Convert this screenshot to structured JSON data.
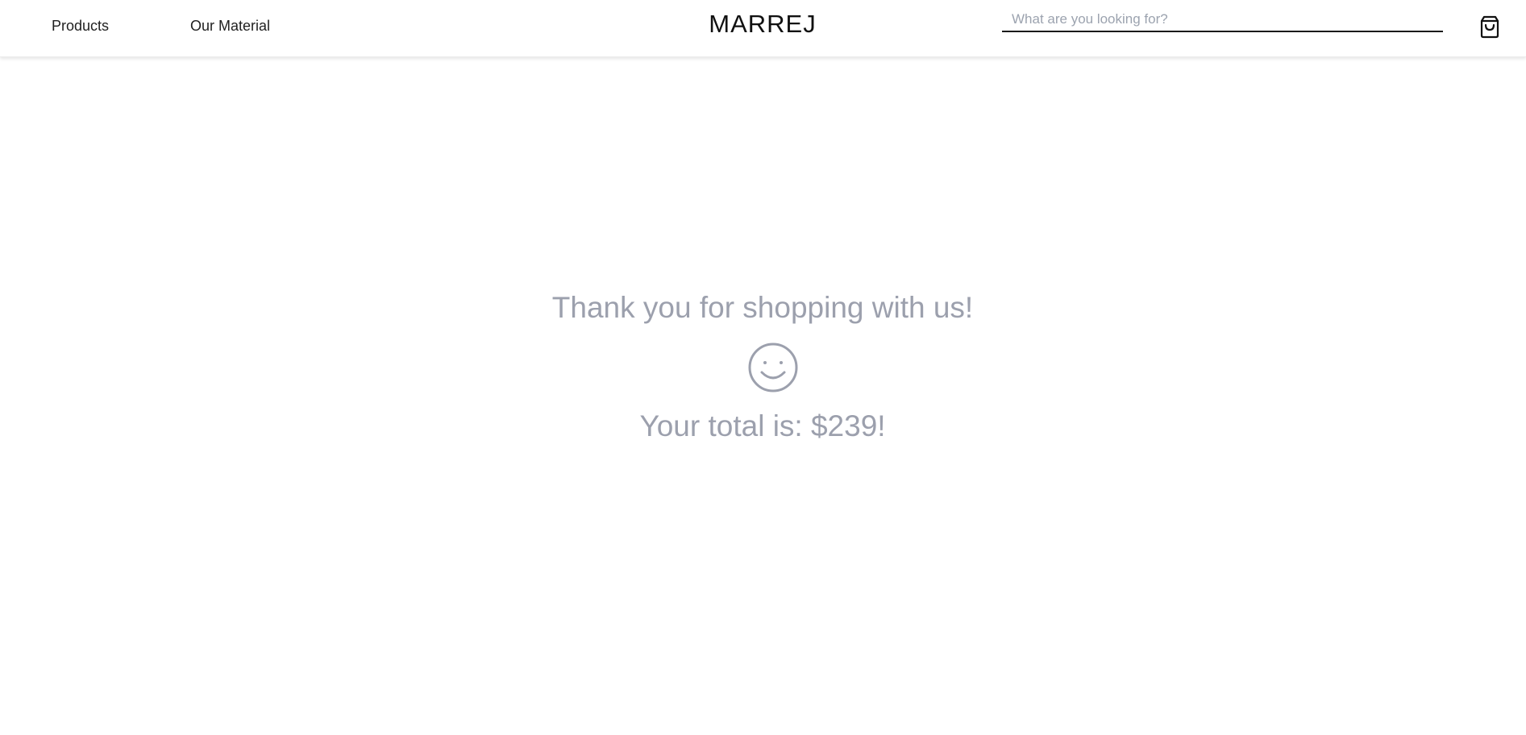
{
  "header": {
    "nav": [
      {
        "label": "Products"
      },
      {
        "label": "Our Material"
      }
    ],
    "brand": "MARREJ",
    "search": {
      "placeholder": "What are you looking for?",
      "value": ""
    },
    "cart_icon": "shopping-bag-icon"
  },
  "main": {
    "thanks_message": "Thank you for shopping with us!",
    "smiley_icon": "smiley-face-icon",
    "total_message": "Your total is: $239!"
  },
  "colors": {
    "muted_text": "#9ca0ad",
    "text": "#1f1f1f",
    "brand_text": "#111111",
    "background": "#ffffff"
  }
}
